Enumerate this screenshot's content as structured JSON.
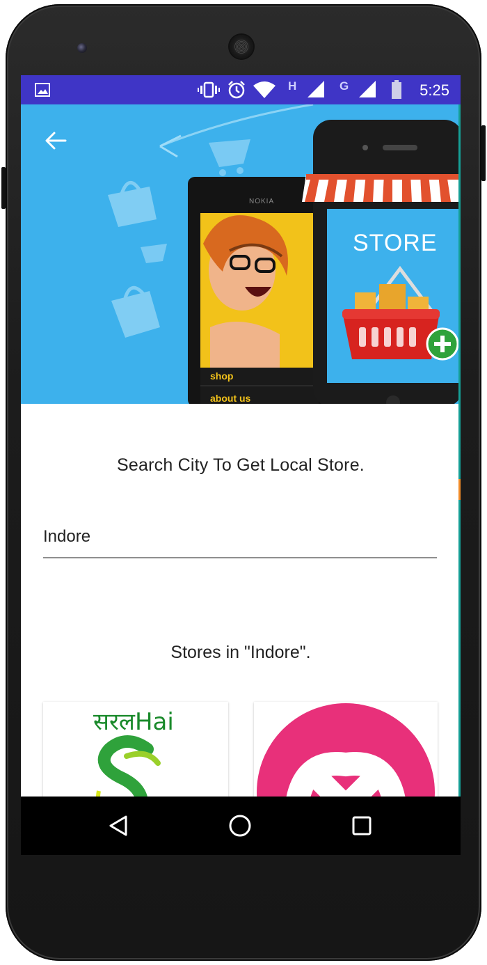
{
  "status_bar": {
    "time": "5:25",
    "network_letter_1": "H",
    "network_letter_2": "G",
    "icons": [
      "image-icon",
      "vibrate-icon",
      "alarm-icon",
      "wifi-icon",
      "signal-icon",
      "signal-icon",
      "battery-icon"
    ]
  },
  "hero": {
    "left_phone_brand": "NOKIA",
    "menu_item_1": "shop",
    "menu_item_2": "about us",
    "store_sign": "STORE"
  },
  "search": {
    "title": "Search City To Get Local Store.",
    "value": "Indore"
  },
  "stores": {
    "title": "Stores in \"Indore\".",
    "cards": [
      {
        "logo_text": "सरलHai"
      },
      {
        "logo_text": ""
      }
    ]
  },
  "colors": {
    "status_bar": "#3f35c6",
    "hero_bg": "#3db1ec",
    "nav_bar": "#000000",
    "store2_logo": "#e8307a"
  }
}
